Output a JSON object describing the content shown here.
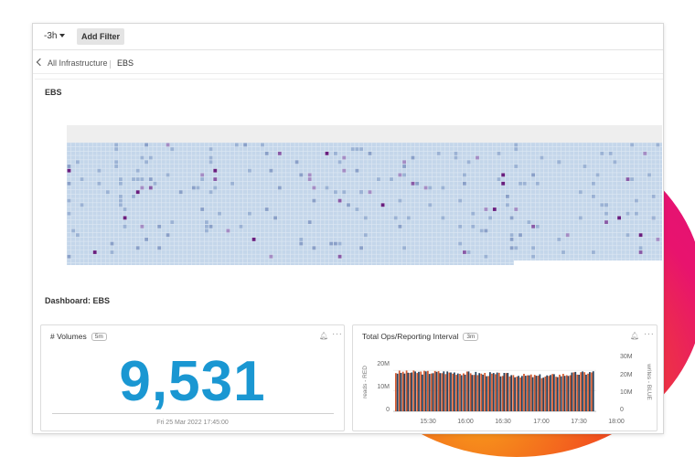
{
  "toolbar": {
    "time_range": "-3h",
    "add_filter_label": "Add Filter"
  },
  "breadcrumb": {
    "back_label": "All Infrastructure",
    "current": "EBS"
  },
  "ebs_panel": {
    "title": "EBS"
  },
  "dashboard": {
    "label": "Dashboard: EBS"
  },
  "volumes_card": {
    "title": "# Volumes",
    "badge": "5m",
    "value": "9,531",
    "timestamp": "Fri 25 Mar 2022 17:45:00"
  },
  "ops_card": {
    "title": "Total Ops/Reporting Interval",
    "badge": "3m",
    "left_axis_label": "reads - RED",
    "right_axis_label": "writes - BLUE",
    "left_ticks": [
      "20M",
      "10M",
      "0"
    ],
    "right_ticks": [
      "30M",
      "20M",
      "10M",
      "0"
    ],
    "x_ticks": [
      "15:30",
      "16:00",
      "16:30",
      "17:00",
      "17:30",
      "18:00"
    ]
  },
  "colors": {
    "accent_blue": "#1a97d2",
    "heat_base": "#c4d6ea",
    "heat_purple": "#6a1e7e",
    "reads_red": "#d35b32",
    "writes_blue": "#26425e"
  },
  "chart_data": {
    "type": "bar",
    "x": [
      "15:30",
      "16:00",
      "16:30",
      "17:00",
      "17:30"
    ],
    "xlim": [
      "15:10",
      "18:00"
    ],
    "series": [
      {
        "name": "reads - RED",
        "values": [
          19,
          19,
          18,
          17,
          19
        ]
      },
      {
        "name": "writes - BLUE",
        "values": [
          19,
          19,
          18,
          17,
          19
        ]
      }
    ],
    "ylim": [
      0,
      25
    ],
    "y_unit": "M",
    "title": "Total Ops/Reporting Interval",
    "ylabel": "reads - RED",
    "y2label": "writes - BLUE"
  }
}
